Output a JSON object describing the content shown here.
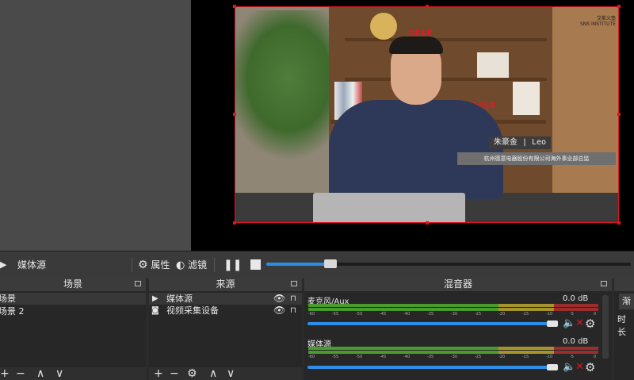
{
  "preview": {
    "overlay_logo": "SNS INSTITUTE",
    "overlay_logo_cn": "艾斯义塾",
    "lower_third_name": "朱豪金 | Leo",
    "lower_third_title": "杭州德意电器股份有限公司海外事业部总监",
    "brand_sign": "DE&E"
  },
  "toolbar": {
    "source_name": "媒体源",
    "properties_label": "属性",
    "filters_label": "滤镜",
    "playback_progress": 0.09
  },
  "scenes": {
    "header": "场景",
    "items": [
      "场景",
      "场景 2"
    ],
    "footer": [
      "+",
      "−",
      "∧",
      "∨"
    ]
  },
  "sources": {
    "header": "来源",
    "items": [
      {
        "label": "媒体源",
        "icon": "play-icon"
      },
      {
        "label": "视频采集设备",
        "icon": "camera-icon"
      }
    ],
    "footer": [
      "+",
      "−",
      "⚙",
      "∧",
      "∨"
    ]
  },
  "mixer": {
    "header": "混音器",
    "channels": [
      {
        "label": "麦克风/Aux",
        "db": "0.0 dB",
        "volume": 1.0
      },
      {
        "label": "媒体源",
        "db": "0.0 dB",
        "volume": 1.0
      }
    ],
    "ticks": [
      "-60",
      "-55",
      "-50",
      "-45",
      "-40",
      "-35",
      "-30",
      "-25",
      "-20",
      "-15",
      "-10",
      "-5",
      "0"
    ]
  },
  "transitions": {
    "partial_button": "渐",
    "partial_label": "时长"
  },
  "colors": {
    "accent": "#2c8ee8",
    "selection": "#e0141e",
    "mute": "#e0141e"
  }
}
